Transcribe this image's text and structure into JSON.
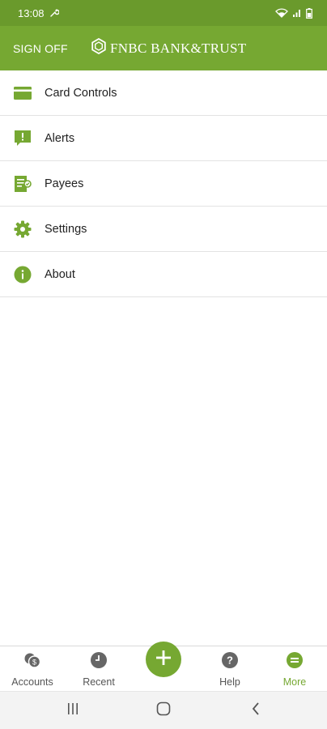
{
  "status_bar": {
    "time": "13:08",
    "icons": [
      "wrench-icon",
      "wifi-icon",
      "signal-icon",
      "battery-icon"
    ]
  },
  "header": {
    "sign_off": "SIGN OFF",
    "brand": "FNBC BANK&TRUST",
    "background": "#76a832"
  },
  "menu": {
    "items": [
      {
        "label": "Card Controls",
        "icon": "credit-card-icon"
      },
      {
        "label": "Alerts",
        "icon": "alert-message-icon"
      },
      {
        "label": "Payees",
        "icon": "payees-document-icon"
      },
      {
        "label": "Settings",
        "icon": "gear-icon"
      },
      {
        "label": "About",
        "icon": "info-icon"
      }
    ]
  },
  "bottom_nav": {
    "items": [
      {
        "label": "Accounts",
        "icon": "accounts-coins-icon"
      },
      {
        "label": "Recent",
        "icon": "clock-icon"
      },
      {
        "label": "Help",
        "icon": "help-icon"
      },
      {
        "label": "More",
        "icon": "more-icon",
        "active": true
      }
    ],
    "fab_icon": "plus-icon",
    "active_color": "#76a832"
  },
  "system_nav": {
    "icons": [
      "recent-apps-icon",
      "home-icon",
      "back-icon"
    ]
  }
}
